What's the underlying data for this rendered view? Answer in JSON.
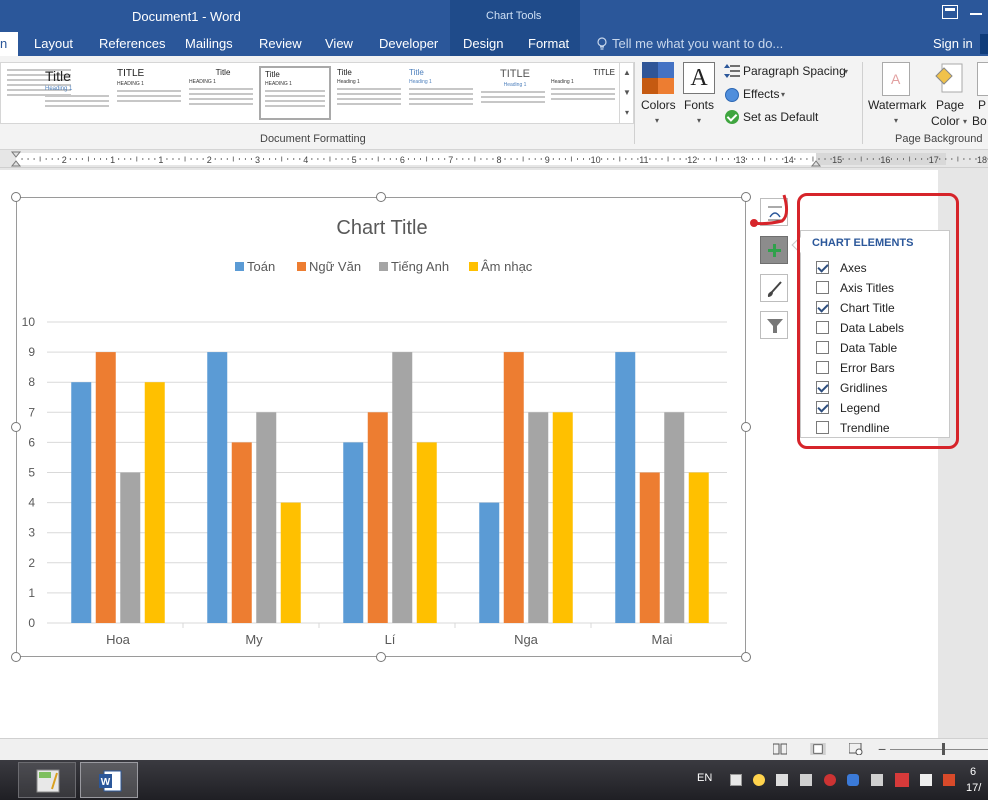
{
  "window": {
    "doc_title": "Document1 - Word",
    "context_tab_group": "Chart Tools"
  },
  "tabs": {
    "home_partial": "n",
    "items": [
      "Layout",
      "References",
      "Mailings",
      "Review",
      "View",
      "Developer",
      "Design",
      "Format"
    ],
    "tell_me": "Tell me what you want to do...",
    "sign_in": "Sign in"
  },
  "ribbon": {
    "style_thumbs": [
      {
        "title": "",
        "sub": "",
        "kind": "text"
      },
      {
        "title": "Title",
        "sub": "Heading 1",
        "kind": "big"
      },
      {
        "title": "TITLE",
        "sub": "HEADING 1",
        "kind": "caps"
      },
      {
        "title": "Title",
        "sub": "HEADING 1",
        "kind": "center"
      },
      {
        "title": "Title",
        "sub": "HEADING 1",
        "kind": "selected"
      },
      {
        "title": "Title",
        "sub": "Heading 1",
        "kind": "plain"
      },
      {
        "title": "Title",
        "sub": "Heading 1",
        "kind": "blue"
      },
      {
        "title": "TITLE",
        "sub": "Heading 1",
        "kind": "spaced"
      },
      {
        "title": "TITLE",
        "sub": "Heading 1",
        "kind": "right"
      }
    ],
    "doc_formatting_label": "Document Formatting",
    "colors_label": "Colors",
    "fonts_label": "Fonts",
    "fonts_glyph": "A",
    "paragraph_spacing_label": "Paragraph Spacing",
    "effects_label": "Effects",
    "set_as_default_label": "Set as Default",
    "watermark_label": "Watermark",
    "page_color_label_1": "Page",
    "page_color_label_2": "Color",
    "page_borders_label_1": "P",
    "page_borders_label_2": "Bo",
    "page_background_label": "Page Background"
  },
  "ruler": {
    "numbers": [
      "2",
      "1",
      "1",
      "2",
      "3",
      "4",
      "5",
      "6",
      "7",
      "8",
      "9",
      "10",
      "11",
      "12",
      "13",
      "14",
      "15",
      "16",
      "17",
      "18",
      "19"
    ]
  },
  "chart_data": {
    "type": "bar",
    "title": "Chart Title",
    "categories": [
      "Hoa",
      "My",
      "Lí",
      "Nga",
      "Mai"
    ],
    "series": [
      {
        "name": "Toán",
        "values": [
          8,
          9,
          6,
          4,
          9
        ],
        "color": "#5b9bd5"
      },
      {
        "name": "Ngữ Văn",
        "values": [
          9,
          6,
          7,
          9,
          5
        ],
        "color": "#ed7d31"
      },
      {
        "name": "Tiếng Anh",
        "values": [
          5,
          7,
          9,
          7,
          7
        ],
        "color": "#a5a5a5"
      },
      {
        "name": "Âm nhạc",
        "values": [
          8,
          4,
          6,
          7,
          5
        ],
        "color": "#ffc000"
      }
    ],
    "ylim": [
      0,
      10
    ],
    "yticks": [
      0,
      1,
      2,
      3,
      4,
      5,
      6,
      7,
      8,
      9,
      10
    ],
    "grid": true,
    "legend": "top"
  },
  "chart_elements": {
    "title": "CHART ELEMENTS",
    "items": [
      {
        "label": "Axes",
        "checked": true
      },
      {
        "label": "Axis Titles",
        "checked": false
      },
      {
        "label": "Chart Title",
        "checked": true
      },
      {
        "label": "Data Labels",
        "checked": false
      },
      {
        "label": "Data Table",
        "checked": false
      },
      {
        "label": "Error Bars",
        "checked": false
      },
      {
        "label": "Gridlines",
        "checked": true
      },
      {
        "label": "Legend",
        "checked": true
      },
      {
        "label": "Trendline",
        "checked": false
      }
    ]
  },
  "taskbar": {
    "language": "EN",
    "clock_partial_1": "6",
    "clock_partial_2": "17/"
  },
  "colors": {
    "word_blue": "#2b579a",
    "annotation_red": "#d6242a"
  }
}
